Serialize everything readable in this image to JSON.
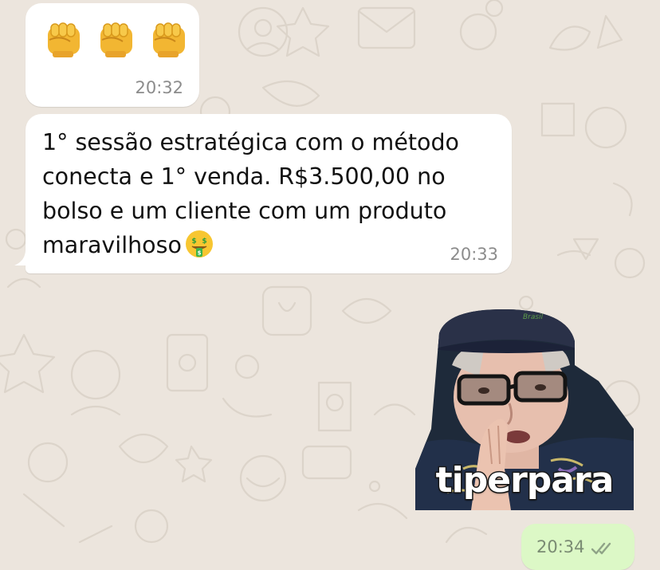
{
  "conversation": {
    "messages": [
      {
        "direction": "incoming",
        "type": "emoji",
        "emoji": "👊👊👊",
        "icons": [
          "fist-icon",
          "fist-icon",
          "fist-icon"
        ],
        "time": "20:32"
      },
      {
        "direction": "incoming",
        "type": "text",
        "text": "1° sessão estratégica com o método\nconecta e 1° venda. R$3.500,00 no\nbolso e um cliente com um produto\nmaravilhoso",
        "emoji_icon": "money-mouth-face-icon",
        "time": "20:33"
      },
      {
        "direction": "outgoing",
        "type": "sticker",
        "caption": "tiperpara",
        "cap_text": "Brasil",
        "time": "20:34",
        "status_icon": "double-check-icon"
      }
    ]
  },
  "colors": {
    "wallpaper": "#ECE5DD",
    "incoming_bubble": "#FFFFFF",
    "outgoing_bubble": "#DCF8C6",
    "timestamp": "#8C8C8C"
  }
}
